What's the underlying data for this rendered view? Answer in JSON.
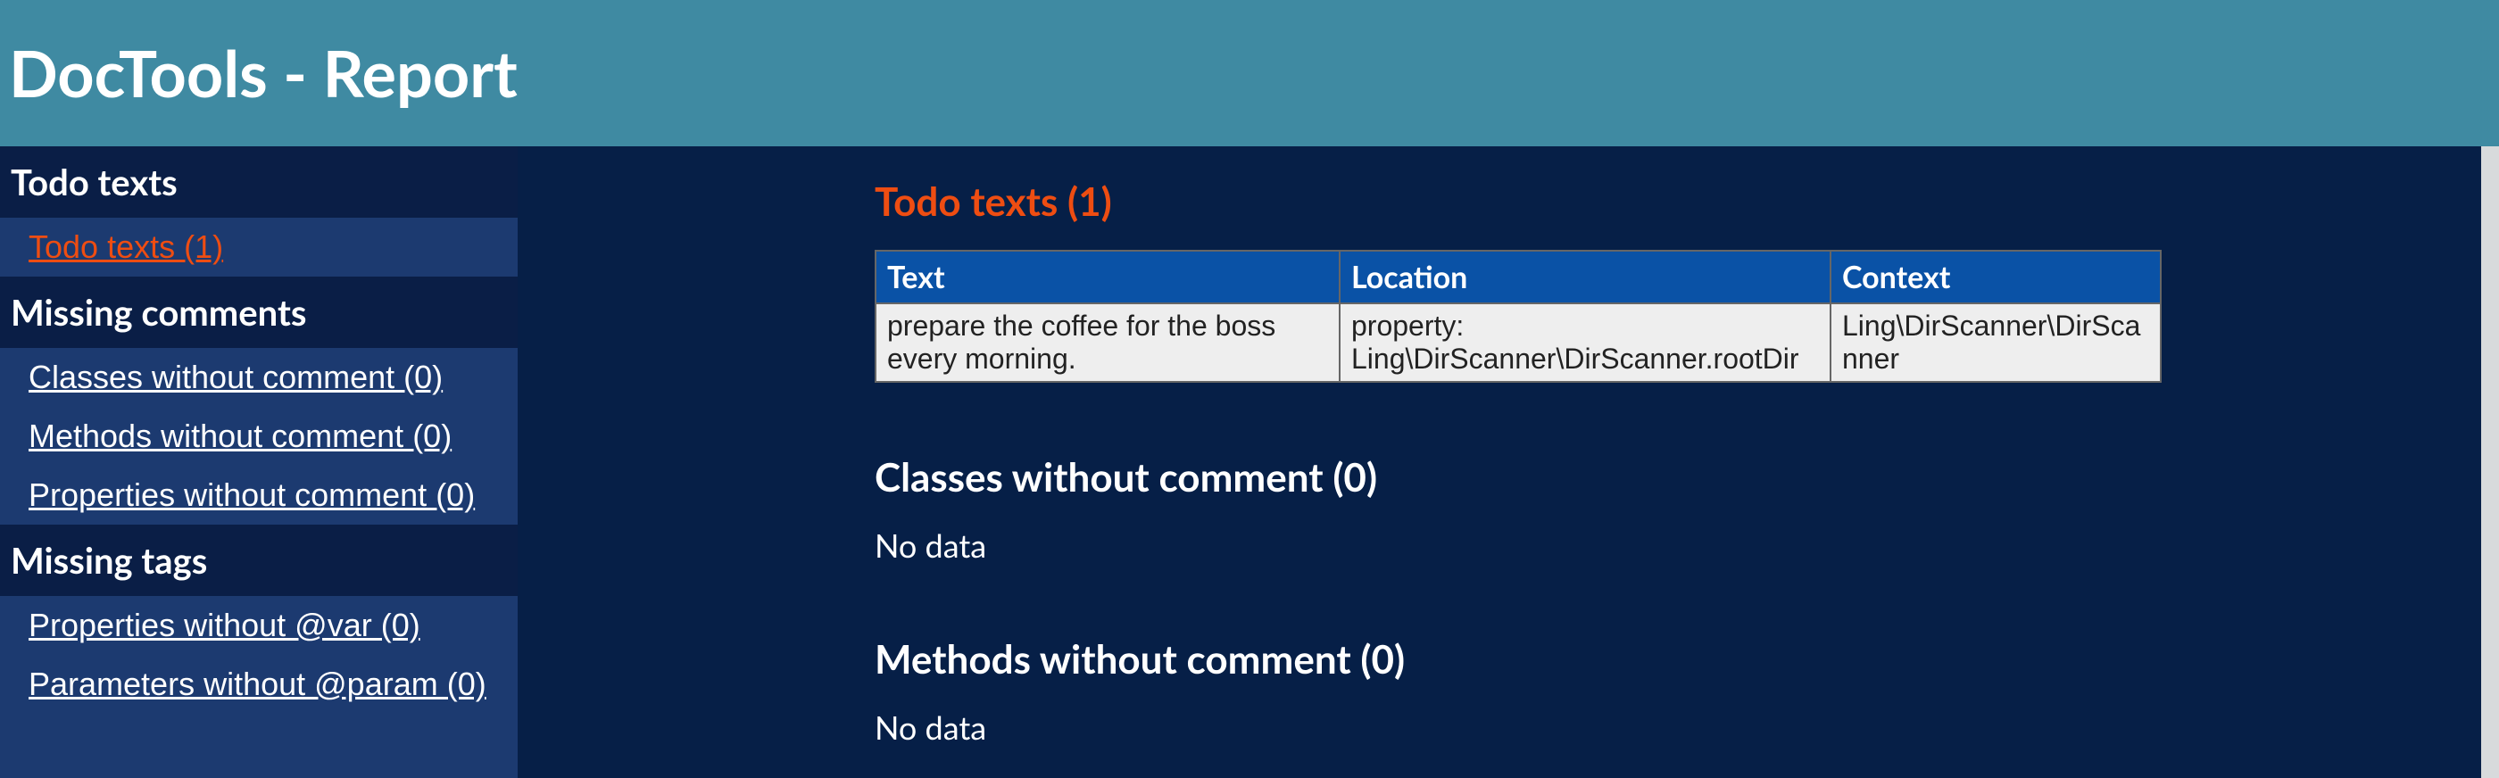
{
  "header": {
    "title": "DocTools - Report"
  },
  "sidebar": {
    "groups": [
      {
        "title": "Todo texts",
        "items": [
          {
            "label": "Todo texts (1)",
            "active": true
          }
        ]
      },
      {
        "title": "Missing comments",
        "items": [
          {
            "label": "Classes without comment (0)",
            "active": false
          },
          {
            "label": "Methods without comment (0)",
            "active": false
          },
          {
            "label": "Properties without comment (0)",
            "active": false
          }
        ]
      },
      {
        "title": "Missing tags",
        "items": [
          {
            "label": "Properties without @var (0)",
            "active": false
          },
          {
            "label": "Parameters without @param (0)",
            "active": false
          }
        ]
      }
    ]
  },
  "main": {
    "sections": {
      "todo": {
        "title": "Todo texts (1)",
        "headers": {
          "text": "Text",
          "location": "Location",
          "context": "Context"
        },
        "rows": [
          {
            "text": "prepare the coffee for the boss every morning.",
            "location": "property: Ling\\DirScanner\\DirScanner.rootDir",
            "context": "Ling\\DirScanner\\DirScanner"
          }
        ]
      },
      "classes": {
        "title": "Classes without comment (0)",
        "empty": "No data"
      },
      "methods": {
        "title": "Methods without comment (0)",
        "empty": "No data"
      }
    }
  }
}
